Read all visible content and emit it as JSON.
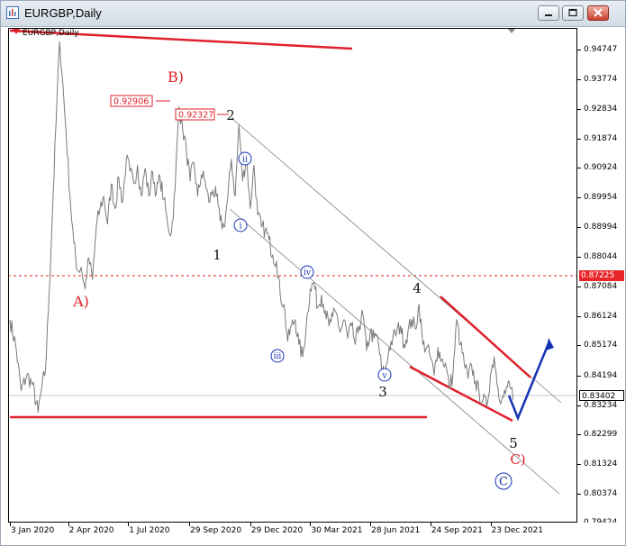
{
  "window": {
    "title": "EURGBP,Daily"
  },
  "chart_data": {
    "type": "line",
    "symbol_label": "EURGBP,Daily",
    "ylim": [
      0.7943,
      0.9545
    ],
    "y_ticks": [
      "0.94747",
      "0.93774",
      "0.92834",
      "0.91874",
      "0.90924",
      "0.89954",
      "0.88994",
      "0.88044",
      "0.87084",
      "0.86124",
      "0.85174",
      "0.84194",
      "0.83234",
      "0.82299",
      "0.81324",
      "0.80374",
      "0.79424"
    ],
    "x_ticks": [
      "3 Jan 2020",
      "2 Apr 2020",
      "1 Jul 2020",
      "29 Sep 2020",
      "29 Dec 2020",
      "30 Mar 2021",
      "28 Jun 2021",
      "24 Sep 2021",
      "23 Dec 2021"
    ],
    "x_tick_index": [
      0,
      62,
      126,
      191,
      256,
      320,
      384,
      448,
      512
    ],
    "price_labels": {
      "hline": "0.87225",
      "current": "0.83402"
    },
    "annotations": {
      "peak1": "0.92906",
      "peak2": "0.92327"
    },
    "series": [
      {
        "values": [
          [
            0,
            0.86
          ],
          [
            6,
            0.852
          ],
          [
            12,
            0.837
          ],
          [
            18,
            0.842
          ],
          [
            24,
            0.839
          ],
          [
            30,
            0.83
          ],
          [
            34,
            0.838
          ],
          [
            38,
            0.844
          ],
          [
            42,
            0.87
          ],
          [
            46,
            0.9
          ],
          [
            50,
            0.93
          ],
          [
            53,
            0.95
          ],
          [
            56,
            0.938
          ],
          [
            60,
            0.92
          ],
          [
            64,
            0.9
          ],
          [
            68,
            0.885
          ],
          [
            72,
            0.876
          ],
          [
            76,
            0.877
          ],
          [
            80,
            0.87
          ],
          [
            84,
            0.88
          ],
          [
            88,
            0.873
          ],
          [
            92,
            0.89
          ],
          [
            96,
            0.896
          ],
          [
            100,
            0.9
          ],
          [
            104,
            0.891
          ],
          [
            108,
            0.904
          ],
          [
            112,
            0.896
          ],
          [
            116,
            0.906
          ],
          [
            120,
            0.898
          ],
          [
            124,
            0.912
          ],
          [
            128,
            0.908
          ],
          [
            132,
            0.904
          ],
          [
            136,
            0.91
          ],
          [
            140,
            0.9
          ],
          [
            144,
            0.909
          ],
          [
            148,
            0.9
          ],
          [
            152,
            0.908
          ],
          [
            156,
            0.901
          ],
          [
            160,
            0.906
          ],
          [
            164,
            0.899
          ],
          [
            168,
            0.891
          ],
          [
            172,
            0.888
          ],
          [
            176,
            0.902
          ],
          [
            180,
            0.929
          ],
          [
            184,
            0.922
          ],
          [
            188,
            0.915
          ],
          [
            192,
            0.905
          ],
          [
            196,
            0.911
          ],
          [
            200,
            0.9
          ],
          [
            204,
            0.907
          ],
          [
            208,
            0.905
          ],
          [
            212,
            0.898
          ],
          [
            216,
            0.902
          ],
          [
            220,
            0.9
          ],
          [
            224,
            0.892
          ],
          [
            228,
            0.89
          ],
          [
            232,
            0.899
          ],
          [
            236,
            0.912
          ],
          [
            240,
            0.9
          ],
          [
            244,
            0.9232
          ],
          [
            248,
            0.905
          ],
          [
            252,
            0.913
          ],
          [
            256,
            0.896
          ],
          [
            260,
            0.91
          ],
          [
            264,
            0.894
          ],
          [
            268,
            0.89
          ],
          [
            272,
            0.889
          ],
          [
            276,
            0.886
          ],
          [
            280,
            0.881
          ],
          [
            284,
            0.879
          ],
          [
            288,
            0.868
          ],
          [
            292,
            0.865
          ],
          [
            296,
            0.853
          ],
          [
            300,
            0.858
          ],
          [
            304,
            0.86
          ],
          [
            308,
            0.852
          ],
          [
            312,
            0.848
          ],
          [
            316,
            0.859
          ],
          [
            320,
            0.87
          ],
          [
            324,
            0.872
          ],
          [
            328,
            0.864
          ],
          [
            332,
            0.868
          ],
          [
            336,
            0.863
          ],
          [
            340,
            0.858
          ],
          [
            344,
            0.861
          ],
          [
            348,
            0.862
          ],
          [
            352,
            0.856
          ],
          [
            356,
            0.86
          ],
          [
            360,
            0.854
          ],
          [
            364,
            0.858
          ],
          [
            368,
            0.852
          ],
          [
            372,
            0.858
          ],
          [
            376,
            0.862
          ],
          [
            380,
            0.85
          ],
          [
            384,
            0.856
          ],
          [
            388,
            0.854
          ],
          [
            392,
            0.854
          ],
          [
            396,
            0.844
          ],
          [
            400,
            0.842
          ],
          [
            404,
            0.851
          ],
          [
            408,
            0.854
          ],
          [
            412,
            0.856
          ],
          [
            416,
            0.858
          ],
          [
            420,
            0.852
          ],
          [
            424,
            0.856
          ],
          [
            428,
            0.86
          ],
          [
            432,
            0.857
          ],
          [
            436,
            0.865
          ],
          [
            440,
            0.852
          ],
          [
            444,
            0.851
          ],
          [
            448,
            0.848
          ],
          [
            452,
            0.842
          ],
          [
            456,
            0.851
          ],
          [
            460,
            0.847
          ],
          [
            464,
            0.846
          ],
          [
            468,
            0.838
          ],
          [
            472,
            0.842
          ],
          [
            476,
            0.86
          ],
          [
            480,
            0.852
          ],
          [
            484,
            0.846
          ],
          [
            488,
            0.841
          ],
          [
            492,
            0.845
          ],
          [
            496,
            0.84
          ],
          [
            500,
            0.836
          ],
          [
            504,
            0.834
          ],
          [
            508,
            0.832
          ],
          [
            512,
            0.842
          ],
          [
            516,
            0.848
          ],
          [
            520,
            0.838
          ],
          [
            524,
            0.834
          ],
          [
            528,
            0.836
          ],
          [
            532,
            0.84
          ],
          [
            536,
            0.834
          ]
        ]
      }
    ],
    "wave_labels": [
      "B)",
      "A)",
      "2",
      "1",
      "3",
      "4",
      "5",
      "C)",
      "C",
      "i",
      "ii",
      "iii",
      "iv",
      "v"
    ]
  }
}
